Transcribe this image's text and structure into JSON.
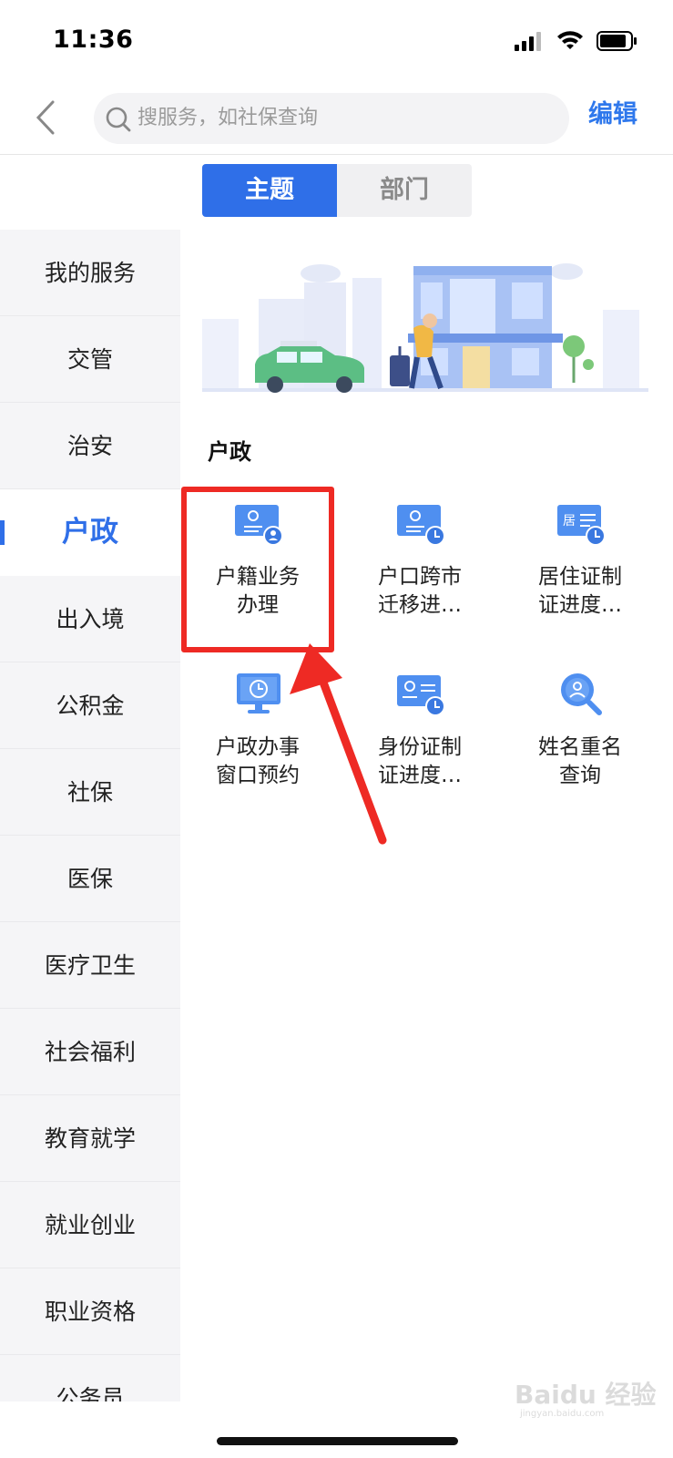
{
  "status_bar": {
    "time": "11:36"
  },
  "nav": {
    "search_placeholder": "搜服务，如社保查询",
    "edit_label": "编辑"
  },
  "tabs": [
    {
      "label": "主题",
      "active": true
    },
    {
      "label": "部门",
      "active": false
    }
  ],
  "sidebar": {
    "items": [
      {
        "label": "我的服务"
      },
      {
        "label": "交管"
      },
      {
        "label": "治安"
      },
      {
        "label": "户政",
        "active": true
      },
      {
        "label": "出入境"
      },
      {
        "label": "公积金"
      },
      {
        "label": "社保"
      },
      {
        "label": "医保"
      },
      {
        "label": "医疗卫生"
      },
      {
        "label": "社会福利"
      },
      {
        "label": "教育就学"
      },
      {
        "label": "就业创业"
      },
      {
        "label": "职业资格"
      },
      {
        "label": "公务员"
      }
    ]
  },
  "section": {
    "title": "户政"
  },
  "services": [
    {
      "line1": "户籍业务",
      "line2": "办理",
      "icon": "id-card-person-icon"
    },
    {
      "line1": "户口跨市",
      "line2": "迁移进…",
      "icon": "id-card-clock-icon"
    },
    {
      "line1": "居住证制",
      "line2": "证进度…",
      "icon": "residence-card-clock-icon",
      "icon_text": "居"
    },
    {
      "line1": "户政办事",
      "line2": "窗口预约",
      "icon": "monitor-clock-icon"
    },
    {
      "line1": "身份证制",
      "line2": "证进度…",
      "icon": "id-card-clock-icon"
    },
    {
      "line1": "姓名重名",
      "line2": "查询",
      "icon": "magnifier-person-icon"
    }
  ],
  "watermark": {
    "text": "Baidu 经验",
    "subtext": "jingyan.baidu.com"
  },
  "colors": {
    "accent": "#2f6fe8",
    "highlight": "#ee2a24",
    "icon_blue": "#4f8ff0"
  }
}
